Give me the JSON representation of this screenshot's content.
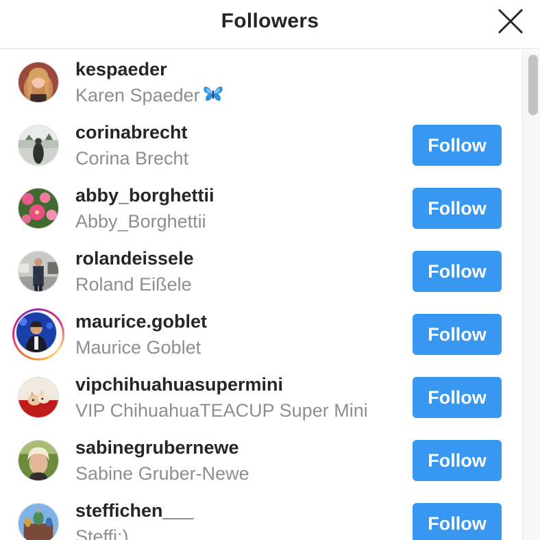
{
  "dialog": {
    "title": "Followers",
    "close_icon": "close-icon"
  },
  "follow_button_color": "#3897f0",
  "followers": [
    {
      "username": "kespaeder",
      "full_name": "Karen Spaeder",
      "emoji": "butterfly",
      "follow_label": ""
    },
    {
      "username": "corinabrecht",
      "full_name": "Corina Brecht",
      "follow_label": "Follow"
    },
    {
      "username": "abby_borghettii",
      "full_name": "Abby_Borghettii",
      "follow_label": "Follow"
    },
    {
      "username": "rolandeissele",
      "full_name": "Roland Eißele",
      "follow_label": "Follow"
    },
    {
      "username": "maurice.goblet",
      "full_name": "Maurice Goblet",
      "follow_label": "Follow",
      "has_story": true
    },
    {
      "username": "vipchihuahuasupermini",
      "full_name": "VIP ChihuahuaTEACUP Super Mini",
      "follow_label": "Follow"
    },
    {
      "username": "sabinegrubernewe",
      "full_name": "Sabine Gruber-Newe",
      "follow_label": "Follow"
    },
    {
      "username": "steffichen___",
      "full_name": "Steffi:)",
      "follow_label": "Follow"
    }
  ]
}
